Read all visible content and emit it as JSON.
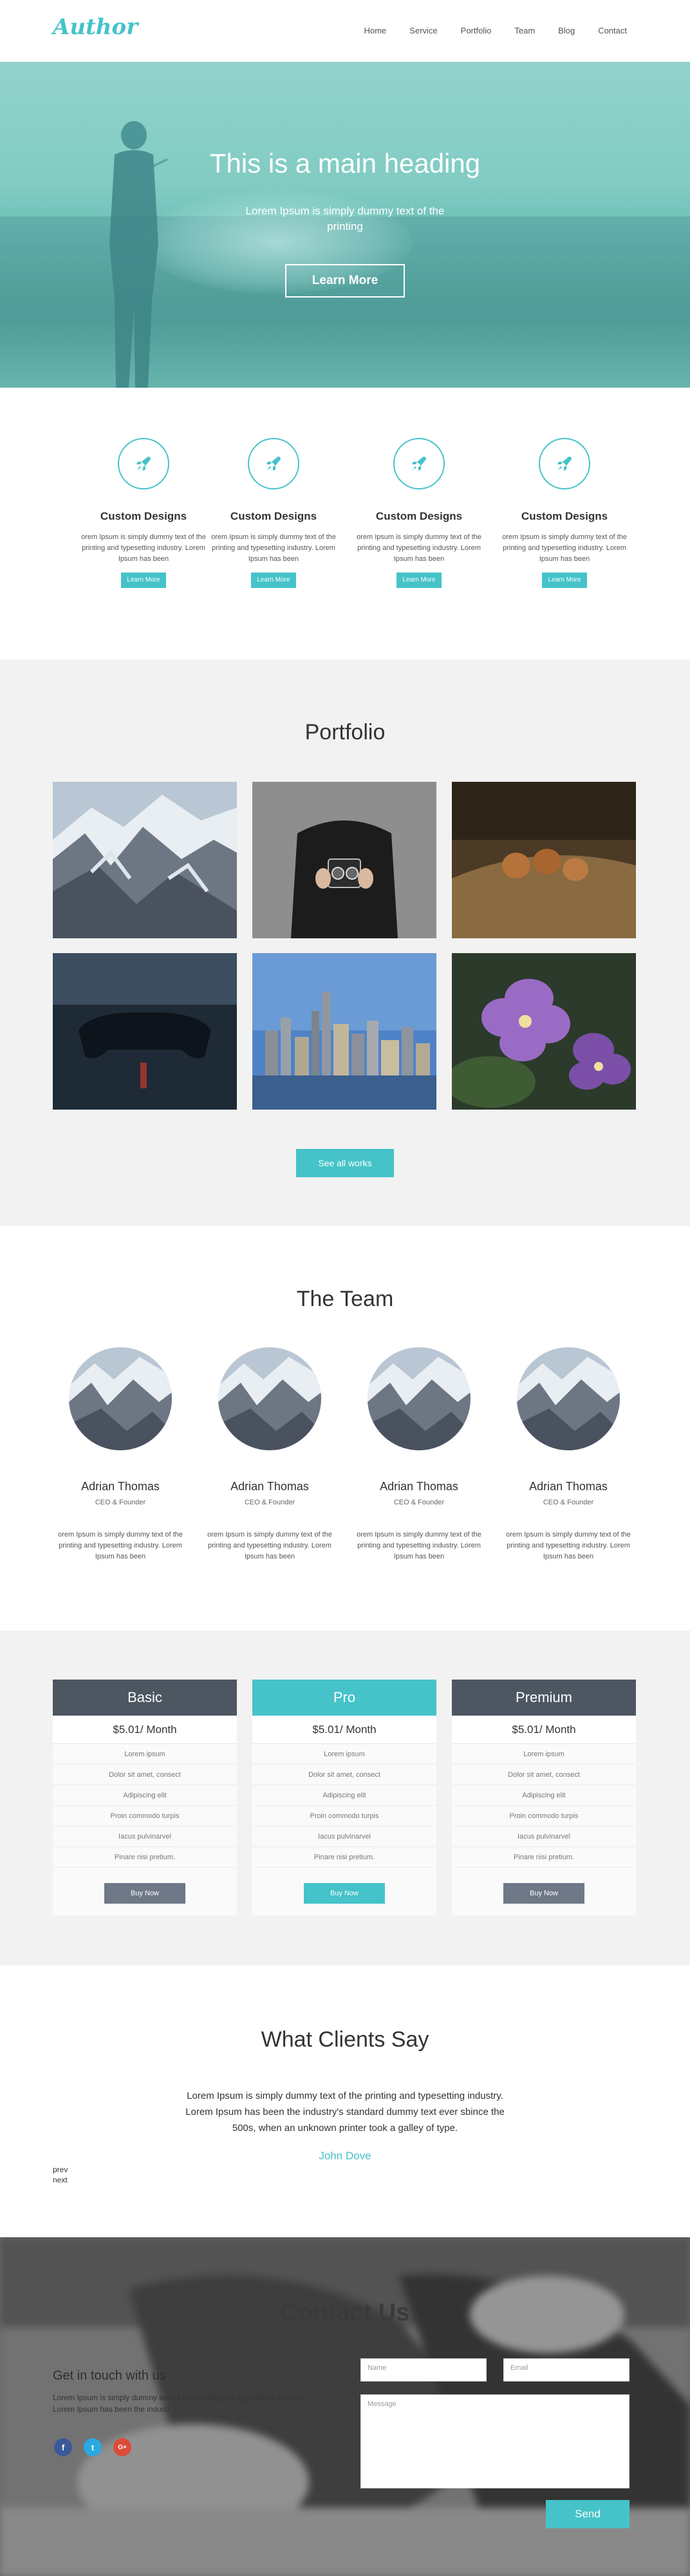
{
  "header": {
    "logo": "Author",
    "nav": [
      "Home",
      "Service",
      "Portfolio",
      "Team",
      "Blog",
      "Contact"
    ]
  },
  "hero": {
    "title": "This is a main heading",
    "subtitle": "Lorem Ipsum is simply dummy text of the printing",
    "button": "Learn More"
  },
  "features": {
    "items": [
      {
        "title": "Custom Designs",
        "text": "orem Ipsum is simply dummy text of the printing and typesetting industry. Lorem Ipsum has been",
        "button": "Learn More",
        "icon": "rocket-icon"
      },
      {
        "title": "Custom Designs",
        "text": "orem Ipsum is simply dummy text of the printing and typesetting industry. Lorem Ipsum has been",
        "button": "Learn More",
        "icon": "rocket-icon"
      },
      {
        "title": "Custom Designs",
        "text": "orem Ipsum is simply dummy text of the printing and typesetting industry. Lorem Ipsum has been",
        "button": "Learn More",
        "icon": "rocket-icon"
      },
      {
        "title": "Custom Designs",
        "text": "orem Ipsum is simply dummy text of the printing and typesetting industry. Lorem Ipsum has been",
        "button": "Learn More",
        "icon": "rocket-icon"
      }
    ]
  },
  "portfolio": {
    "title": "Portfolio",
    "button": "See all works"
  },
  "team": {
    "title": "The Team",
    "members": [
      {
        "name": "Adrian Thomas",
        "role": "CEO & Founder",
        "text": "orem Ipsum is simply dummy text of the printing and typesetting industry. Lorem Ipsum has been"
      },
      {
        "name": "Adrian Thomas",
        "role": "CEO & Founder",
        "text": "orem Ipsum is simply dummy text of the printing and typesetting industry. Lorem Ipsum has been"
      },
      {
        "name": "Adrian Thomas",
        "role": "CEO & Founder",
        "text": "orem Ipsum is simply dummy text of the printing and typesetting industry. Lorem Ipsum has been"
      },
      {
        "name": "Adrian Thomas",
        "role": "CEO & Founder",
        "text": "orem Ipsum is simply dummy text of the printing and typesetting industry. Lorem Ipsum has been"
      }
    ]
  },
  "pricing": {
    "plans": [
      {
        "name": "Basic",
        "price": "$5.01/ Month",
        "features": [
          "Lorem ipsum",
          "Dolor sit amet, consect",
          "Adipiscing elit",
          "Proin commodo turpis",
          "Iacus pulvinarvel",
          "Pinare nisi pretium."
        ],
        "button": "Buy Now",
        "head_color": "#4d5762",
        "button_color": "#6e7887"
      },
      {
        "name": "Pro",
        "price": "$5.01/ Month",
        "features": [
          "Lorem ipsum",
          "Dolor sit amet, consect",
          "Adipiscing elit",
          "Proin commodo turpis",
          "Iacus pulvinarvel",
          "Pinare nisi pretium."
        ],
        "button": "Buy Now",
        "head_color": "#45c3c9",
        "button_color": "#45c3c9"
      },
      {
        "name": "Premium",
        "price": "$5.01/ Month",
        "features": [
          "Lorem ipsum",
          "Dolor sit amet, consect",
          "Adipiscing elit",
          "Proin commodo turpis",
          "Iacus pulvinarvel",
          "Pinare nisi pretium."
        ],
        "button": "Buy Now",
        "head_color": "#4d5762",
        "button_color": "#6e7887"
      }
    ]
  },
  "clients": {
    "title": "What Clients Say",
    "quote": "Lorem Ipsum is simply dummy text of the printing and typesetting industry. Lorem Ipsum has been the industry's standard dummy text ever sbince the 500s, when an unknown printer took a galley of type.",
    "author": "John Dove",
    "prev": "prev",
    "next": "next"
  },
  "contact": {
    "title": "Contact Us",
    "lead": "Get in touch with us",
    "body": "Lorem Ipsum is simply dummy text of the printing and typesetting industry. Lorem Ipsum has been the industr",
    "social": [
      "f",
      "t",
      "G+"
    ],
    "name_placeholder": "Name",
    "email_placeholder": "Email",
    "message_placeholder": "Message",
    "send": "Send"
  },
  "colors": {
    "accent": "#45c3c9",
    "dark_plan": "#4d5762",
    "facebook": "#3b5998",
    "twitter": "#2aa9e0",
    "google": "#dd4b39"
  }
}
